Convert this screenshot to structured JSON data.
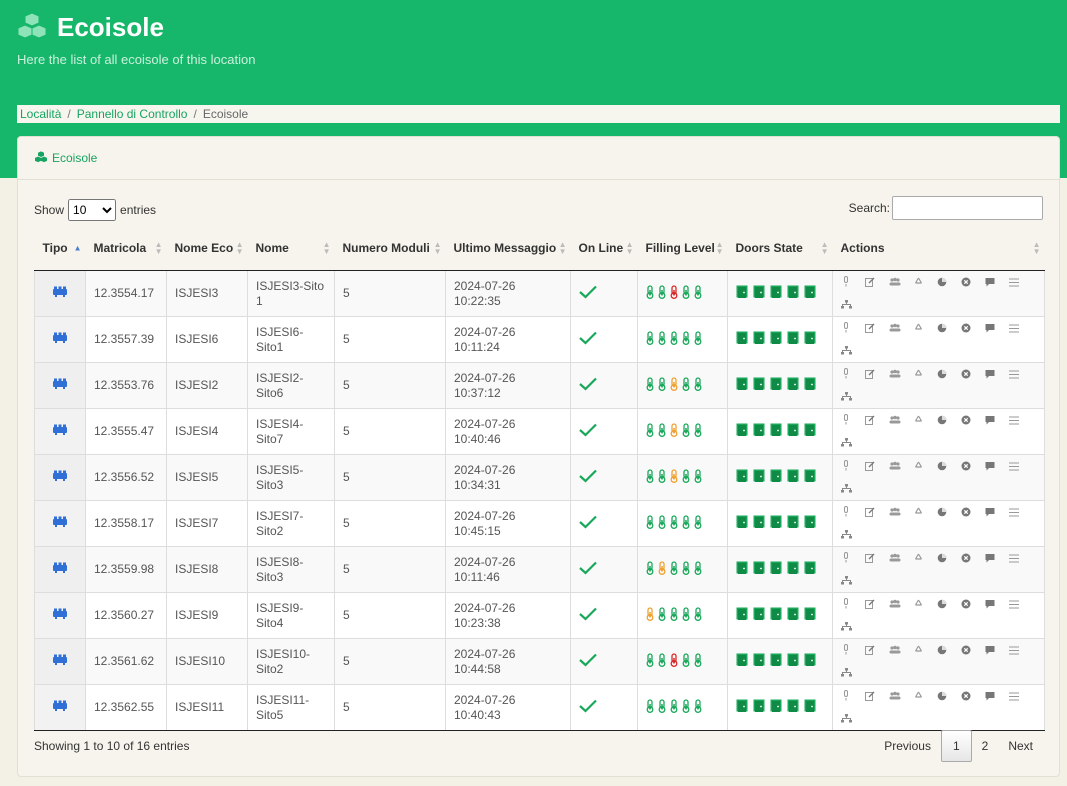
{
  "header": {
    "title": "Ecoisole",
    "subtitle": "Here the list of all ecoisole of this location",
    "logo_icon": "cubes-icon"
  },
  "breadcrumb": [
    {
      "label": "Località"
    },
    {
      "label": "Pannello di Controllo"
    },
    {
      "label": "Ecoisole"
    }
  ],
  "card": {
    "title": "Ecoisole",
    "icon": "cubes-icon"
  },
  "length_control": {
    "show_label": "Show",
    "entries_label": "entries",
    "selected": "10",
    "options": [
      "10"
    ]
  },
  "search": {
    "label": "Search:",
    "value": ""
  },
  "table": {
    "columns": [
      "Tipo",
      "Matricola",
      "Nome Eco",
      "Nome",
      "Numero Moduli",
      "Ultimo Messaggio",
      "On Line",
      "Filling Level",
      "Doors State",
      "Actions"
    ],
    "sorted_column": "Tipo",
    "sort_direction": "ascending",
    "rows": [
      {
        "matricola": "12.3554.17",
        "nome_eco": "ISJESI3",
        "nome": "ISJESI3-Sito 1",
        "moduli": "5",
        "ultimo_date": "2024-07-26",
        "ultimo_time": "10:22:35",
        "online": true,
        "fill": [
          "green",
          "green",
          "red",
          "green",
          "green"
        ],
        "doors": 5
      },
      {
        "matricola": "12.3557.39",
        "nome_eco": "ISJESI6",
        "nome": "ISJESI6-Sito1",
        "moduli": "5",
        "ultimo_date": "2024-07-26",
        "ultimo_time": "10:11:24",
        "online": true,
        "fill": [
          "green",
          "green",
          "green",
          "green",
          "green"
        ],
        "doors": 5
      },
      {
        "matricola": "12.3553.76",
        "nome_eco": "ISJESI2",
        "nome": "ISJESI2-Sito6",
        "moduli": "5",
        "ultimo_date": "2024-07-26",
        "ultimo_time": "10:37:12",
        "online": true,
        "fill": [
          "green",
          "green",
          "orange",
          "green",
          "green"
        ],
        "doors": 5
      },
      {
        "matricola": "12.3555.47",
        "nome_eco": "ISJESI4",
        "nome": "ISJESI4-Sito7",
        "moduli": "5",
        "ultimo_date": "2024-07-26",
        "ultimo_time": "10:40:46",
        "online": true,
        "fill": [
          "green",
          "green",
          "orange",
          "green",
          "green"
        ],
        "doors": 5
      },
      {
        "matricola": "12.3556.52",
        "nome_eco": "ISJESI5",
        "nome": "ISJESI5-Sito3",
        "moduli": "5",
        "ultimo_date": "2024-07-26",
        "ultimo_time": "10:34:31",
        "online": true,
        "fill": [
          "green",
          "green",
          "orange",
          "green",
          "green"
        ],
        "doors": 5
      },
      {
        "matricola": "12.3558.17",
        "nome_eco": "ISJESI7",
        "nome": "ISJESI7-Sito2",
        "moduli": "5",
        "ultimo_date": "2024-07-26",
        "ultimo_time": "10:45:15",
        "online": true,
        "fill": [
          "green",
          "green",
          "green",
          "green",
          "green"
        ],
        "doors": 5
      },
      {
        "matricola": "12.3559.98",
        "nome_eco": "ISJESI8",
        "nome": "ISJESI8-Sito3",
        "moduli": "5",
        "ultimo_date": "2024-07-26",
        "ultimo_time": "10:11:46",
        "online": true,
        "fill": [
          "green",
          "orange",
          "green",
          "green",
          "green"
        ],
        "doors": 5
      },
      {
        "matricola": "12.3560.27",
        "nome_eco": "ISJESI9",
        "nome": "ISJESI9-Sito4",
        "moduli": "5",
        "ultimo_date": "2024-07-26",
        "ultimo_time": "10:23:38",
        "online": true,
        "fill": [
          "orange",
          "green",
          "green",
          "green",
          "green"
        ],
        "doors": 5
      },
      {
        "matricola": "12.3561.62",
        "nome_eco": "ISJESI10",
        "nome": "ISJESI10-Sito2",
        "moduli": "5",
        "ultimo_date": "2024-07-26",
        "ultimo_time": "10:44:58",
        "online": true,
        "fill": [
          "green",
          "green",
          "red",
          "green",
          "green"
        ],
        "doors": 5
      },
      {
        "matricola": "12.3562.55",
        "nome_eco": "ISJESI11",
        "nome": "ISJESI11-Sito5",
        "moduli": "5",
        "ultimo_date": "2024-07-26",
        "ultimo_time": "10:40:43",
        "online": true,
        "fill": [
          "green",
          "green",
          "green",
          "green",
          "green"
        ],
        "doors": 5
      }
    ],
    "action_icons": [
      "microphone-icon",
      "edit-icon",
      "users-icon",
      "recycle-icon",
      "pie-chart-icon",
      "close-circle-icon",
      "comment-icon",
      "list-icon",
      "sitemap-icon"
    ]
  },
  "footer": {
    "info": "Showing 1 to 10 of 16 entries",
    "pagination": {
      "previous": "Previous",
      "pages": [
        "1",
        "2"
      ],
      "current": "1",
      "next": "Next"
    }
  },
  "colors": {
    "brand": "#17b76b",
    "link": "#17a362",
    "type_icon": "#2f6fd6",
    "fill_green": "#19a85a",
    "fill_orange": "#f0a030",
    "fill_red": "#dc2626",
    "check": "#19a85a",
    "action": "#888888"
  }
}
